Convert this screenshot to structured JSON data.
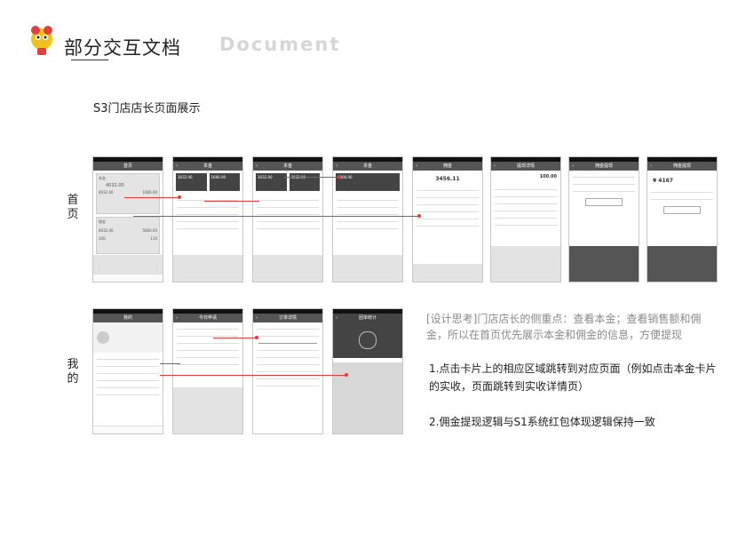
{
  "header": {
    "title_zh": "部分交互文档",
    "title_en": "Document"
  },
  "section": {
    "title": "S3门店店长页面展示"
  },
  "rows": {
    "home_label": "首页",
    "mine_label": "我的"
  },
  "screens_row1": [
    {
      "title": "首页",
      "amount": "4032.00",
      "amount2": "1666.00",
      "amount3": "4032.00",
      "amount4": "5000.00",
      "num1": "100",
      "num2": "110"
    },
    {
      "title": "本金",
      "a": "3032.00",
      "b": "1666.00"
    },
    {
      "title": "本金",
      "a": "3032.00",
      "b": "3032.00"
    },
    {
      "title": "本金",
      "a": "4000.00"
    },
    {
      "title": "佣金",
      "value": "3456.11"
    },
    {
      "title": "提现详情",
      "value": "100.00"
    },
    {
      "title": "佣金提现"
    },
    {
      "title": "佣金提现",
      "value": "4167"
    }
  ],
  "screens_row2": [
    {
      "title": "我的"
    },
    {
      "title": "今日申请"
    },
    {
      "title": "订单详情"
    },
    {
      "title": "团单统计"
    }
  ],
  "notes": {
    "thinking": "[设计思考]门店店长的侧重点：查看本金；查看销售额和佣金，所以在首页优先展示本金和佣金的信息，方便提现",
    "point1": "1.点击卡片上的相应区域跳转到对应页面（例如点击本金卡片的实收，页面跳转到实收详情页）",
    "point2": "2.佣金提现逻辑与S1系统红包体现逻辑保持一致"
  },
  "colors": {
    "accent": "#e03c3c",
    "nav": "#555555"
  }
}
